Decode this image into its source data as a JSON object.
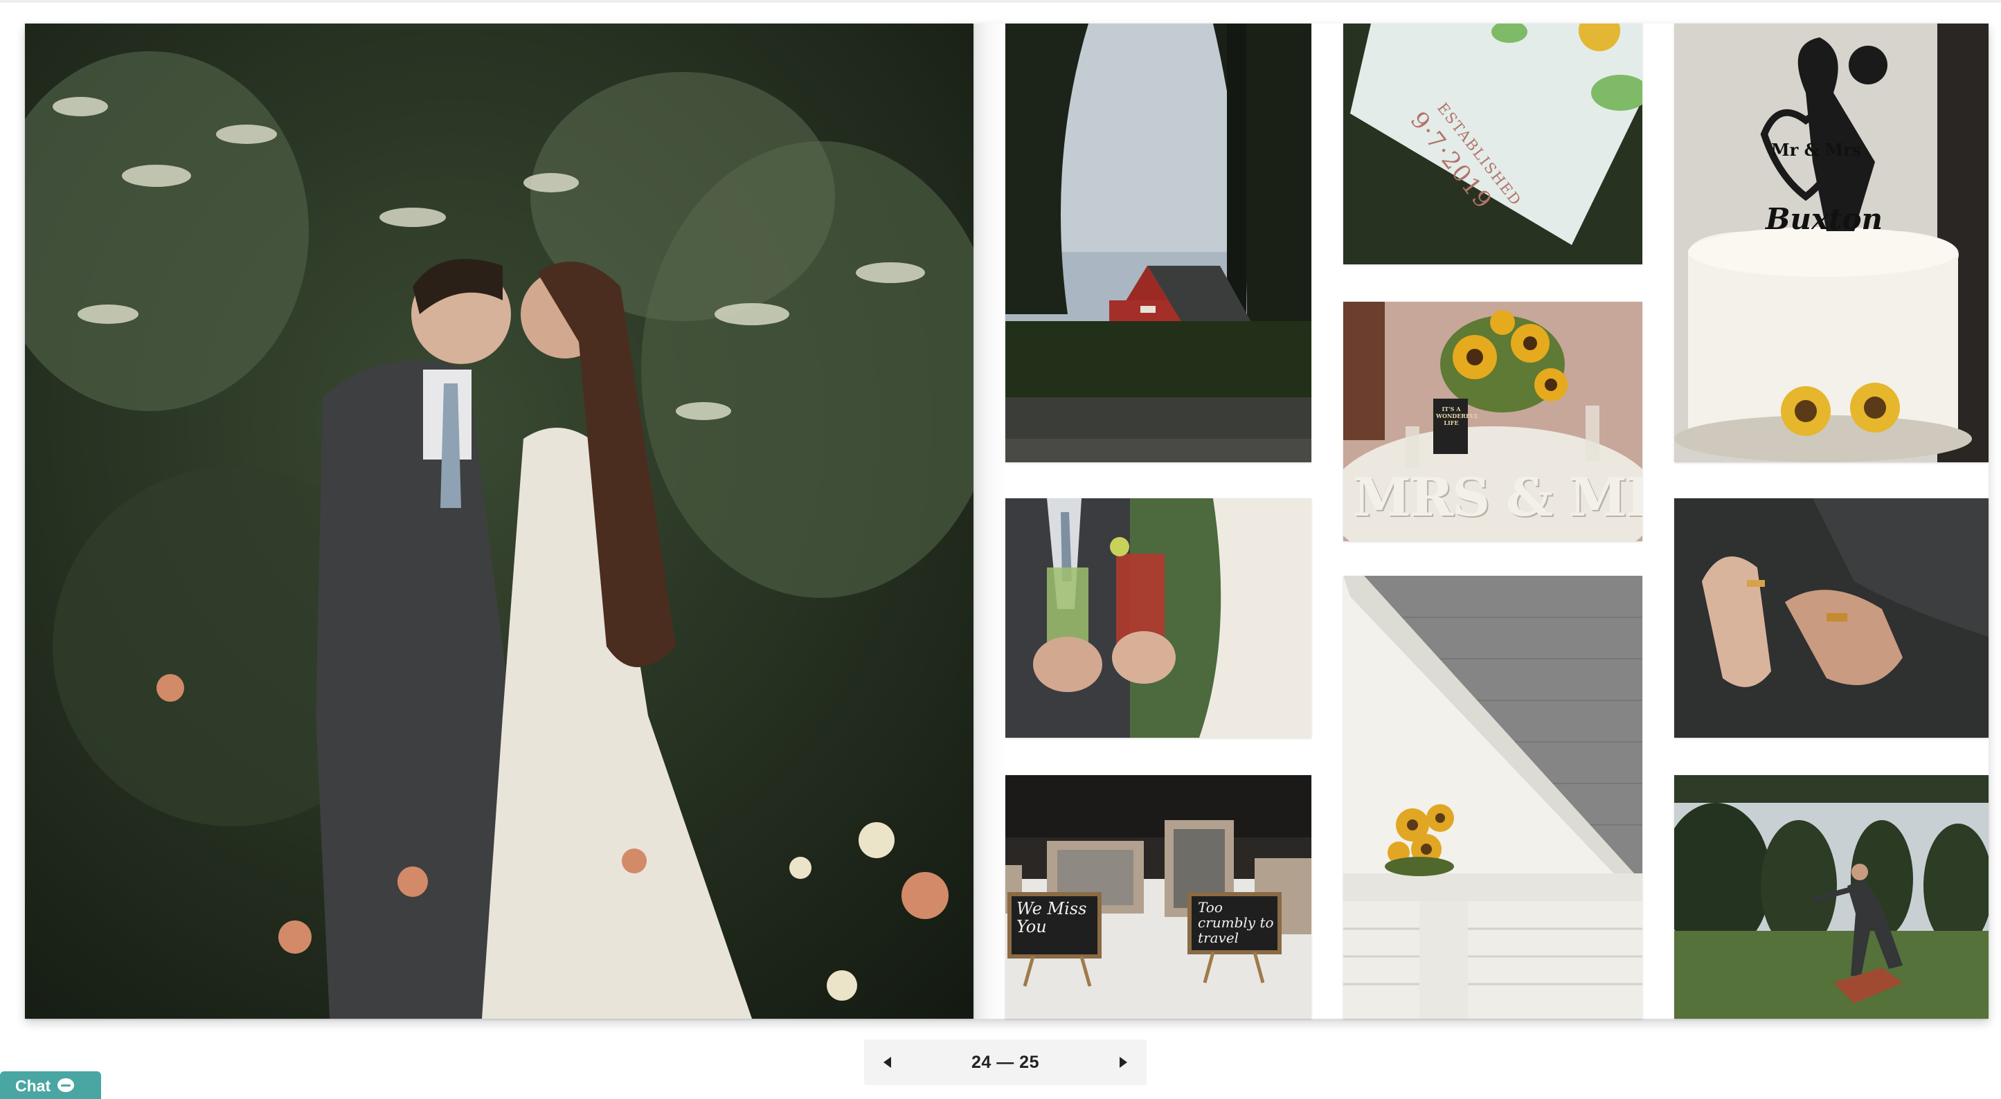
{
  "album": {
    "photos": [
      {
        "id": "couple-kiss",
        "icon": "photo-couple-kiss"
      },
      {
        "id": "red-barn",
        "icon": "photo-red-barn"
      },
      {
        "id": "established-card",
        "icon": "photo-established-card",
        "text_line1": "ESTABLISHED",
        "text_line2": "9·7·2019"
      },
      {
        "id": "cake-topper",
        "icon": "photo-cake-topper",
        "text_line1": "Mr & Mrs",
        "text_line2": "Buxton"
      },
      {
        "id": "sunflower-centerpiece",
        "icon": "photo-sunflower-centerpiece",
        "text_line1": "MRS & MR",
        "text_line2": "IT'S A WONDERFUL LIFE"
      },
      {
        "id": "cocktail-toast",
        "icon": "photo-cocktail-toast"
      },
      {
        "id": "wedding-rings",
        "icon": "photo-wedding-rings"
      },
      {
        "id": "church-roof-sunflowers",
        "icon": "photo-church-roof-sunflowers"
      },
      {
        "id": "memory-table",
        "icon": "photo-memory-table",
        "text_line1": "We Miss You",
        "text_line2": "Too crumbly to travel"
      },
      {
        "id": "cornhole-game",
        "icon": "photo-cornhole-game"
      }
    ]
  },
  "pager": {
    "prev_icon": "triangle-left-icon",
    "next_icon": "triangle-right-icon",
    "label": "24 — 25"
  },
  "chat": {
    "label": "Chat",
    "icon": "chat-bubble-icon",
    "color": "#4aa6a2"
  }
}
